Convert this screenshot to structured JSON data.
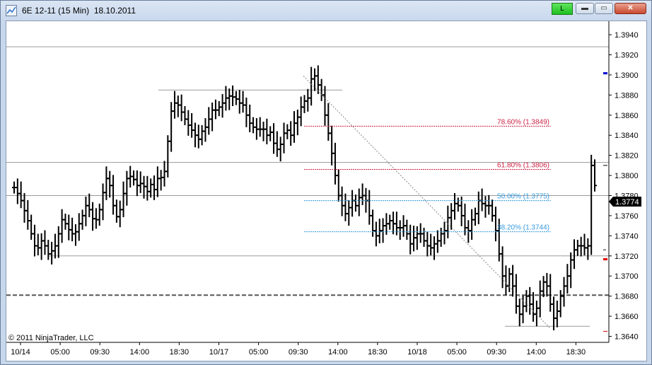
{
  "window": {
    "title": "6E 12-11 (15 Min)  18.10.2011",
    "link_button_label": "L",
    "minimize_label": "▬",
    "maximize_label": "▭",
    "close_label": "✕"
  },
  "colors": {
    "window_bg": "#c7d7ec",
    "bar": "#000000",
    "fib_red": "#cc2244",
    "fib_blue": "#3399dd",
    "current_price_bg": "#000000",
    "link_green": "#2ecc2e"
  },
  "chart_data": {
    "type": "ohlc-bar",
    "instrument": "6E 12-11",
    "interval": "15 Min",
    "ylim": [
      1.3634,
      1.3952
    ],
    "y_ticks": [
      "1.3940",
      "1.3920",
      "1.3900",
      "1.3880",
      "1.3860",
      "1.3840",
      "1.3820",
      "1.3800",
      "1.3780",
      "1.3760",
      "1.3740",
      "1.3720",
      "1.3700",
      "1.3680",
      "1.3660",
      "1.3640"
    ],
    "x_ticks": [
      "10/14",
      "05:00",
      "09:30",
      "14:00",
      "18:30",
      "10/17",
      "05:00",
      "09:30",
      "14:00",
      "18:30",
      "10/18",
      "05:00",
      "09:30",
      "14:00",
      "18:30"
    ],
    "current_price": "1.3774",
    "copyright": "© 2011 NinjaTrader, LLC",
    "fibonacci": [
      {
        "label": "78.60% (1.3849)",
        "price": 1.3849,
        "color": "red"
      },
      {
        "label": "61.80% (1.3806)",
        "price": 1.3806,
        "color": "red"
      },
      {
        "label": "50.00% (1.3775)",
        "price": 1.3775,
        "color": "blue"
      },
      {
        "label": "38.20% (1.3744)",
        "price": 1.3744,
        "color": "blue"
      }
    ],
    "series_closes": [
      1.3788,
      1.3782,
      1.3775,
      1.3765,
      1.3755,
      1.3742,
      1.373,
      1.3728,
      1.3735,
      1.373,
      1.3722,
      1.3725,
      1.373,
      1.3742,
      1.3756,
      1.3752,
      1.3746,
      1.3742,
      1.3744,
      1.3752,
      1.376,
      1.377,
      1.3766,
      1.3757,
      1.3756,
      1.3766,
      1.3783,
      1.3797,
      1.379,
      1.377,
      1.3759,
      1.3766,
      1.3782,
      1.3797,
      1.3799,
      1.3796,
      1.379,
      1.3792,
      1.3789,
      1.3784,
      1.3791,
      1.3786,
      1.3797,
      1.3798,
      1.3804,
      1.3834,
      1.3864,
      1.3872,
      1.387,
      1.3863,
      1.3856,
      1.385,
      1.3845,
      1.384,
      1.3836,
      1.3844,
      1.3848,
      1.3856,
      1.3865,
      1.3865,
      1.3868,
      1.3872,
      1.3877,
      1.3879,
      1.3878,
      1.3876,
      1.3872,
      1.387,
      1.386,
      1.3852,
      1.3848,
      1.3846,
      1.3846,
      1.3846,
      1.384,
      1.3843,
      1.3832,
      1.3826,
      1.3831,
      1.3842,
      1.3845,
      1.384,
      1.3852,
      1.3858,
      1.3868,
      1.3874,
      1.3877,
      1.3896,
      1.3899,
      1.389,
      1.388,
      1.386,
      1.3842,
      1.3822,
      1.38,
      1.378,
      1.377,
      1.3762,
      1.3768,
      1.3775,
      1.377,
      1.3778,
      1.378,
      1.3775,
      1.376,
      1.3745,
      1.374,
      1.3745,
      1.375,
      1.3752,
      1.3755,
      1.3752,
      1.3748,
      1.3748,
      1.375,
      1.3742,
      1.3732,
      1.3738,
      1.3742,
      1.3742,
      1.3735,
      1.373,
      1.3728,
      1.3732,
      1.3735,
      1.3742,
      1.3745,
      1.3758,
      1.3765,
      1.3772,
      1.377,
      1.376,
      1.3748,
      1.3745,
      1.3756,
      1.3762,
      1.3775,
      1.3772,
      1.377,
      1.377,
      1.376,
      1.3745,
      1.3722,
      1.37,
      1.369,
      1.3702,
      1.369,
      1.367,
      1.3662,
      1.367,
      1.368,
      1.3672,
      1.3662,
      1.3668,
      1.3685,
      1.3694,
      1.369,
      1.3672,
      1.3658,
      1.3665,
      1.368,
      1.369,
      1.37,
      1.3716,
      1.3726,
      1.373,
      1.373,
      1.3728,
      1.373,
      1.381,
      1.379
    ]
  }
}
